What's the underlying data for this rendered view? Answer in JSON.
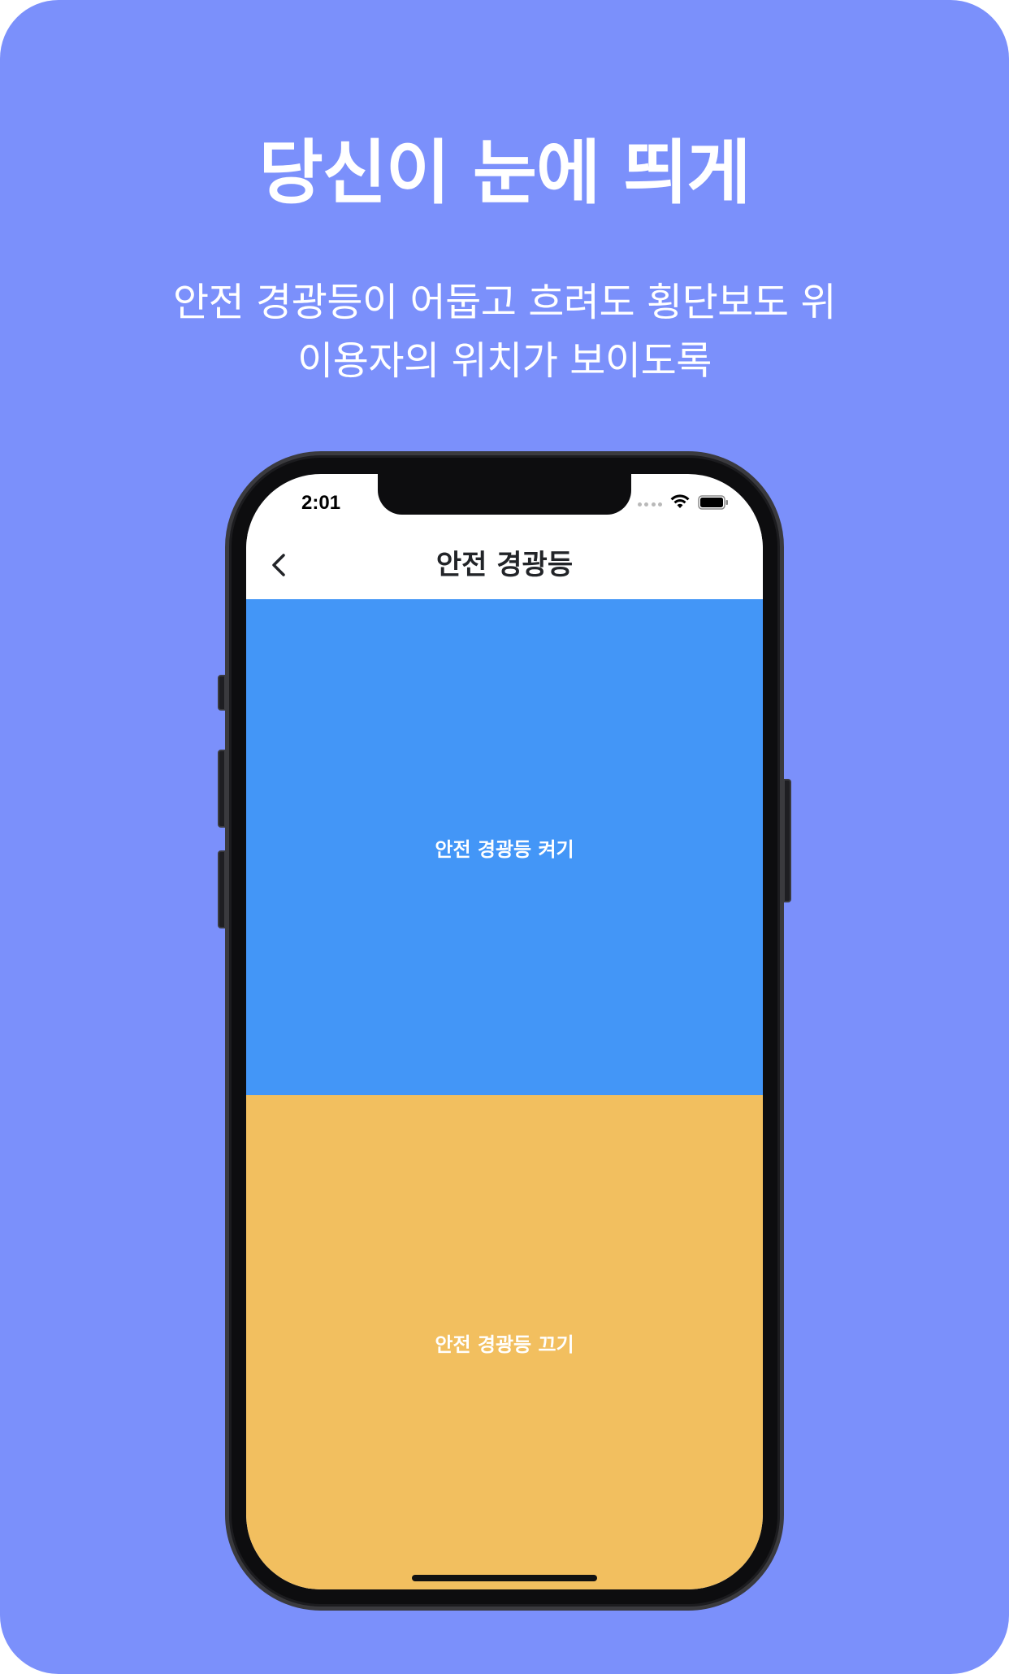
{
  "promo": {
    "headline": "당신이 눈에 띄게",
    "subline_1": "안전 경광등이 어둡고 흐려도 횡단보도 위",
    "subline_2": "이용자의 위치가 보이도록"
  },
  "status_bar": {
    "time": "2:01",
    "icons": [
      "signal-dots-icon",
      "wifi-icon",
      "battery-icon"
    ]
  },
  "nav": {
    "title": "안전 경광등",
    "back_icon": "chevron-left-icon"
  },
  "panels": {
    "on_label": "안전 경광등 켜기",
    "off_label": "안전 경광등 끄기"
  },
  "colors": {
    "background": "#7b90fb",
    "on_panel": "#4396f7",
    "off_panel": "#f2bf5f",
    "title_text": "#222428"
  }
}
